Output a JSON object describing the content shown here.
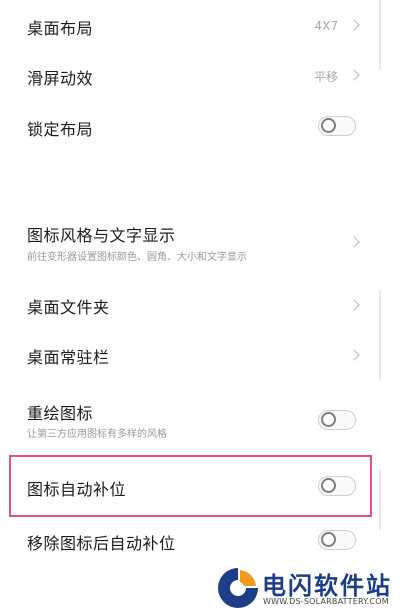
{
  "settings": {
    "layout": {
      "title": "桌面布局",
      "value": "4X7"
    },
    "scroll_effect": {
      "title": "滑屏动效",
      "value": "平移"
    },
    "lock_layout": {
      "title": "锁定布局",
      "enabled": false
    },
    "icon_style": {
      "title": "图标风格与文字显示",
      "subtitle": "前往变形器设置图标颜色、圆角、大小和文字显示"
    },
    "folder": {
      "title": "桌面文件夹"
    },
    "dock": {
      "title": "桌面常驻栏"
    },
    "repaint_icons": {
      "title": "重绘图标",
      "subtitle": "让第三方应用图标有多样的风格",
      "enabled": false
    },
    "auto_fill": {
      "title": "图标自动补位",
      "enabled": false
    },
    "auto_fill_after_remove": {
      "title": "移除图标后自动补位",
      "enabled": false
    }
  },
  "watermark": {
    "name": "电闪软件站",
    "url": "WWW.DS-SOLARBATTERY.COM"
  },
  "colors": {
    "highlight": "#e14f8c",
    "watermark_blue": "#1d3d86",
    "watermark_orange": "#f29a1f"
  }
}
